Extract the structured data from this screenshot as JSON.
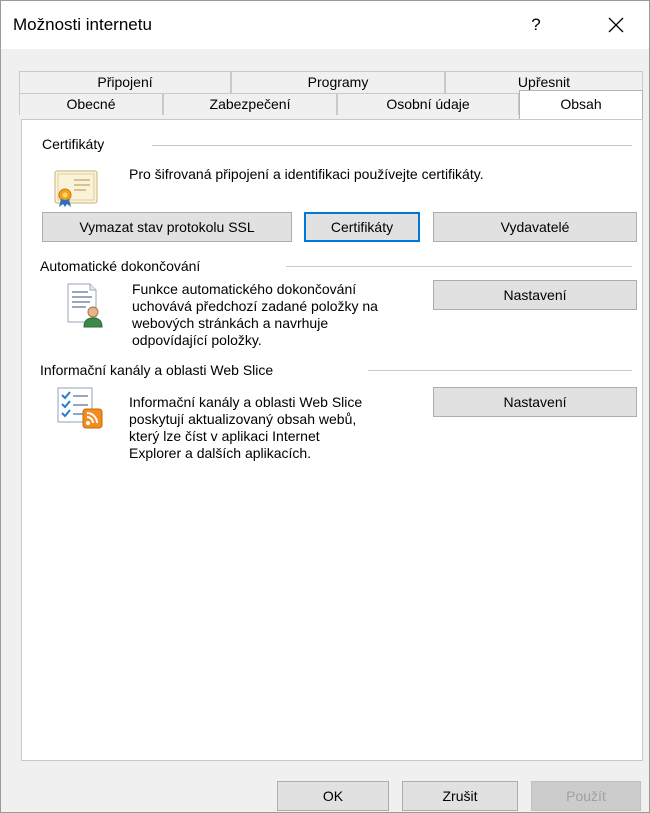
{
  "window": {
    "title": "Možnosti internetu",
    "help": "?"
  },
  "tabs": {
    "row_back": [
      "Připojení",
      "Programy",
      "Upřesnit"
    ],
    "row_front": [
      "Obecné",
      "Zabezpečení",
      "Osobní údaje",
      "Obsah"
    ],
    "active": "Obsah"
  },
  "certificates": {
    "heading": "Certifikáty",
    "description": "Pro šifrovaná připojení a identifikaci používejte certifikáty.",
    "buttons": [
      "Vymazat stav protokolu SSL",
      "Certifikáty",
      "Vydavatelé"
    ]
  },
  "autocomplete": {
    "heading": "Automatické dokončování",
    "description": "Funkce automatického dokončování\nuchovává předchozí zadané položky na\nwebových stránkách a navrhuje\nodpovídající položky.",
    "button": "Nastavení"
  },
  "feeds": {
    "heading": "Informační kanály a oblasti Web Slice",
    "description": "Informační kanály a oblasti Web Slice\nposkytují aktualizovaný obsah webů,\nkterý lze číst v aplikaci Internet\nExplorer a dalších aplikacích.",
    "button": "Nastavení"
  },
  "footer": {
    "ok": "OK",
    "cancel": "Zrušit",
    "apply": "Použít"
  },
  "icons": {
    "certificate": "certificate-icon",
    "autocomplete": "autocomplete-icon",
    "feeds": "feeds-icon",
    "close": "close-icon"
  }
}
